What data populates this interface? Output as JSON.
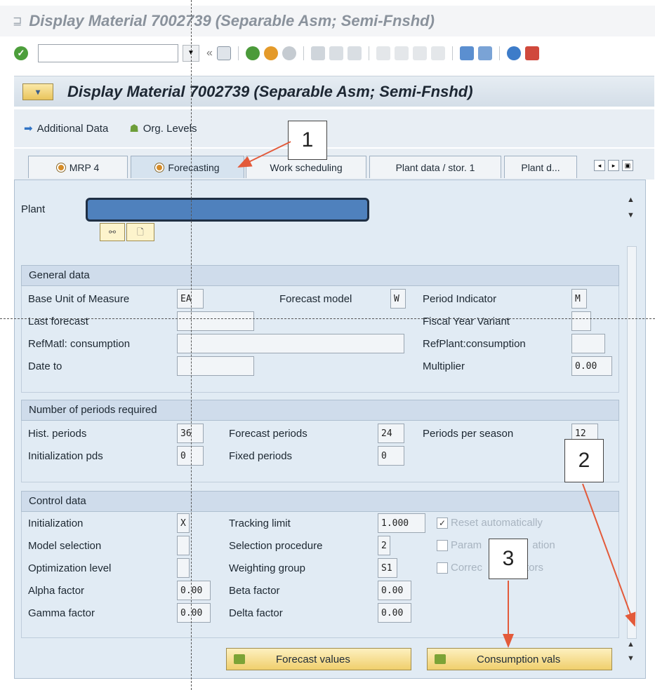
{
  "window_title": "Display Material 7002739 (Separable Asm; Semi-Fnshd)",
  "header_title": "Display Material 7002739 (Separable Asm; Semi-Fnshd)",
  "app_toolbar": {
    "additional_data": "Additional Data",
    "org_levels": "Org. Levels"
  },
  "tabs": [
    "MRP 4",
    "Forecasting",
    "Work scheduling",
    "Plant data / stor. 1",
    "Plant d..."
  ],
  "plant_label": "Plant",
  "general": {
    "title": "General data",
    "base_uom_label": "Base Unit of Measure",
    "base_uom": "EA",
    "forecast_model_label": "Forecast model",
    "forecast_model": "W",
    "period_indicator_label": "Period Indicator",
    "period_indicator": "M",
    "last_forecast_label": "Last forecast",
    "fiscal_year_label": "Fiscal Year Variant",
    "refmatl_label": "RefMatl: consumption",
    "refplant_label": "RefPlant:consumption",
    "date_to_label": "Date to",
    "multiplier_label": "Multiplier",
    "multiplier": "0.00"
  },
  "periods": {
    "title": "Number of periods required",
    "hist_label": "Hist. periods",
    "hist": "36",
    "forecast_label": "Forecast periods",
    "forecast": "24",
    "season_label": "Periods per season",
    "season": "12",
    "init_label": "Initialization pds",
    "init": "0",
    "fixed_label": "Fixed periods",
    "fixed": "0"
  },
  "control": {
    "title": "Control data",
    "init_label": "Initialization",
    "init": "X",
    "tracking_label": "Tracking limit",
    "tracking": "1.000",
    "reset_label": "Reset automatically",
    "model_sel_label": "Model selection",
    "sel_proc_label": "Selection procedure",
    "sel_proc": "2",
    "param_label": "Param",
    "param_label2": "ation",
    "opt_label": "Optimization level",
    "weight_label": "Weighting group",
    "weight": "S1",
    "corr_label": "Correc",
    "corr_label2": "tors",
    "alpha_label": "Alpha factor",
    "alpha": "0.00",
    "beta_label": "Beta factor",
    "beta": "0.00",
    "gamma_label": "Gamma factor",
    "gamma": "0.00",
    "delta_label": "Delta factor",
    "delta": "0.00"
  },
  "buttons": {
    "forecast_values": "Forecast values",
    "consumption_vals": "Consumption vals"
  },
  "callouts": [
    "1",
    "2",
    "3"
  ],
  "colors": {
    "accent": "#e35a3a",
    "panel": "#e1ebf4",
    "button": "#f0cf6c"
  }
}
